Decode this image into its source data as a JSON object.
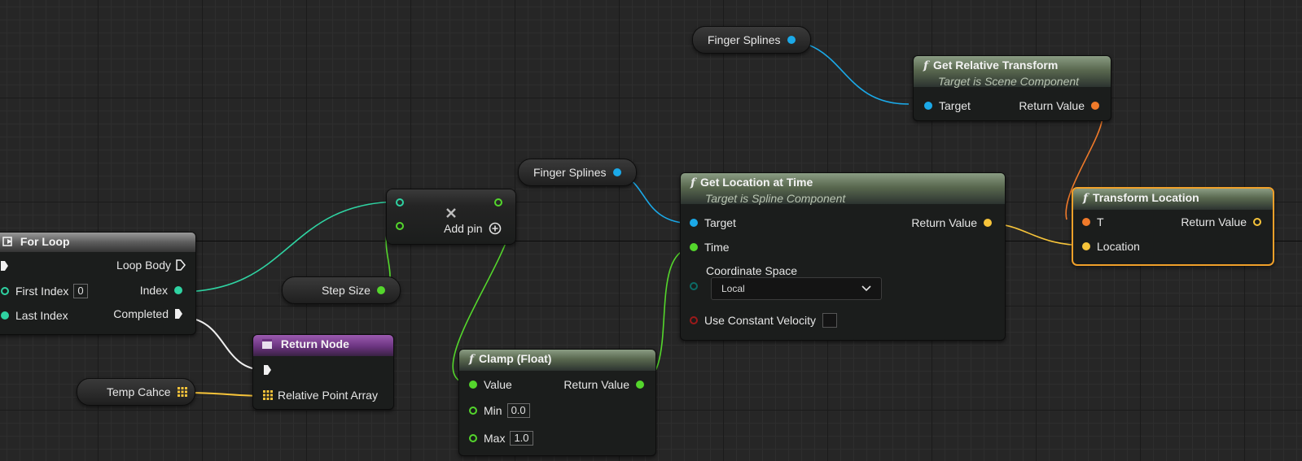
{
  "colors": {
    "object_pin": "#1ba9e8",
    "int_pin": "#2fd3a2",
    "float_pin": "#54d62c",
    "vector_pin": "#f7c43a",
    "transform_pin": "#f07a2a",
    "bool_pin": "#9c1a1a",
    "enum_pin": "#0c6b66",
    "exec_pin": "#f0f0f0",
    "selection": "#f0a02a"
  },
  "variables": {
    "finger_splines_top": "Finger Splines",
    "finger_splines_mid": "Finger Splines",
    "step_size": "Step Size",
    "temp_cache": "Temp Cahce"
  },
  "for_loop": {
    "title": "For Loop",
    "loop_body": "Loop Body",
    "first_index_label": "First Index",
    "first_index_value": "0",
    "index_label": "Index",
    "last_index_label": "Last Index",
    "completed_label": "Completed"
  },
  "add_node": {
    "add_pin_label": "Add pin",
    "remove_icon": "cross-icon",
    "add_icon": "plus-circle-icon"
  },
  "get_relative_transform": {
    "title": "Get Relative Transform",
    "subtitle": "Target is Scene Component",
    "target_label": "Target",
    "return_label": "Return Value"
  },
  "get_location_at_time": {
    "title": "Get Location at Time",
    "subtitle": "Target is Spline Component",
    "target_label": "Target",
    "return_label": "Return Value",
    "time_label": "Time",
    "coord_space_label": "Coordinate Space",
    "coord_space_value": "Local",
    "constant_velocity_label": "Use Constant Velocity"
  },
  "transform_location": {
    "title": "Transform Location",
    "t_label": "T",
    "return_label": "Return Value",
    "location_label": "Location"
  },
  "return_node": {
    "title": "Return Node",
    "array_label": "Relative Point Array"
  },
  "clamp": {
    "title": "Clamp (Float)",
    "value_label": "Value",
    "return_label": "Return Value",
    "min_label": "Min",
    "min_value": "0.0",
    "max_label": "Max",
    "max_value": "1.0"
  }
}
